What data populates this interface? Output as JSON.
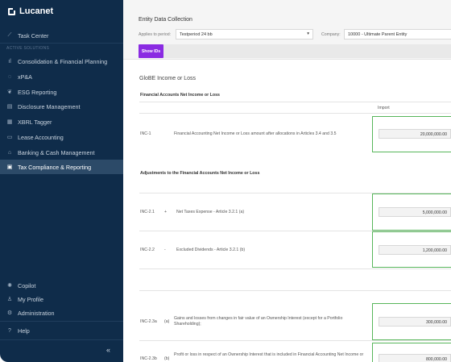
{
  "app": {
    "name": "Lucanet"
  },
  "sidebar": {
    "section_label": "ACTIVE SOLUTIONS",
    "top_item": {
      "label": "Task Center",
      "icon": "chart-line-icon"
    },
    "items": [
      {
        "label": "Consolidation & Financial Planning",
        "icon": "bar-chart-icon"
      },
      {
        "label": "xP&A",
        "icon": "circle-icon"
      },
      {
        "label": "ESG Reporting",
        "icon": "leaf-icon"
      },
      {
        "label": "Disclosure Management",
        "icon": "document-icon"
      },
      {
        "label": "XBRL Tagger",
        "icon": "grid-icon"
      },
      {
        "label": "Lease Accounting",
        "icon": "file-icon"
      },
      {
        "label": "Banking & Cash Management",
        "icon": "bank-icon"
      },
      {
        "label": "Tax Compliance & Reporting",
        "icon": "tax-icon",
        "active": true
      }
    ],
    "bottom_items": [
      {
        "label": "Copilot",
        "icon": "sparkle-icon"
      },
      {
        "label": "My Profile",
        "icon": "user-icon"
      },
      {
        "label": "Administration",
        "icon": "gear-icon"
      }
    ],
    "help": {
      "label": "Help",
      "icon": "help-icon"
    },
    "collapse_label": "«"
  },
  "header": {
    "title": "Entity Data Collection",
    "period_label": "Applies to period:",
    "period_value": "Testperiod 24 bb",
    "company_label": "Company:",
    "company_value": "10000 - Ultimate Parent Entity",
    "show_button": "Show IDs"
  },
  "content": {
    "section_title": "GloBE Income or Loss",
    "group1_title": "Financial Accounts Net Income or Loss",
    "import_header": "Import",
    "group2_title": "Adjustments to the Financial Accounts Net Income or Loss",
    "rows": [
      {
        "code": "INC-1",
        "sign": "",
        "text": "Financial Accounting Net Income or Loss amount after allocations in Articles 3.4 and 3.5",
        "value": "20,000,000.00"
      },
      {
        "code": "INC-2.1",
        "sign": "+",
        "text": "Net Taxes Expense - Article 3.2.1 (a)",
        "value": "5,000,000.00"
      },
      {
        "code": "INC-2.2",
        "sign": "-",
        "text": "Excluded Dividends - Article 3.2.1 (b)",
        "value": "1,200,000.00"
      },
      {
        "code": "INC-2.3a",
        "sign": "(a)",
        "text": "Gains and losses from changes in fair value of an Ownership Interest (except for a Portfolio Shareholding);",
        "value": "300,000.00"
      },
      {
        "code": "INC-2.3b",
        "sign": "(b)",
        "text": "Profit or loss in respect of an Ownership Interest that is included in Financial Accounting Net Income or",
        "value": "800,000.00"
      }
    ]
  }
}
